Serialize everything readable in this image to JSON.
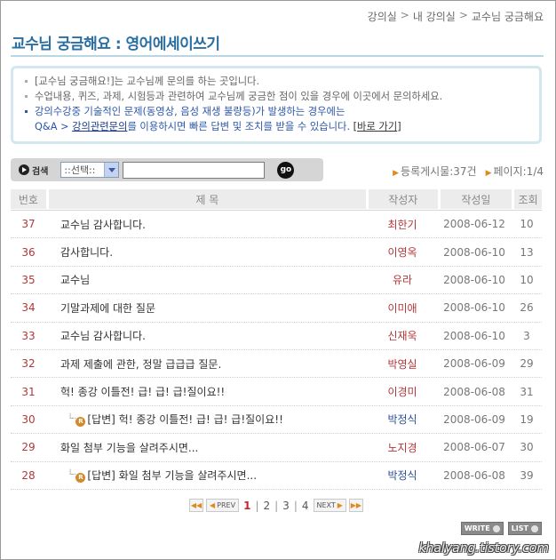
{
  "breadcrumb": [
    "강의실",
    "내 강의실",
    "교수님 궁금해요"
  ],
  "page_title": "교수님 궁금해요 : 영어에세이쓰기",
  "notice": {
    "line1": "[교수님 궁금해요!]는 교수님께 문의를 하는 곳입니다.",
    "line2": "수업내용, 퀴즈, 과제, 시험등과 관련하여 교수님께 궁금한 점이 있을 경우에 이곳에서 문의하세요.",
    "line3": "강의수강중 기술적인 문제(동영상, 음성 재생 불량등)가 발생하는 경우에는",
    "line4_prefix": "Q&A > ",
    "line4_link": "강의관련문의",
    "line4_suffix": "를 이용하시면 빠른 답변 및 조치를 받을 수 있습니다. ",
    "shortcut": "바로 가기"
  },
  "search": {
    "label": "검색",
    "select_value": "::선택::",
    "input_value": "",
    "go_label": "go"
  },
  "stats": {
    "count_label": "등록게시물:37건",
    "page_label": "페이지:1/4"
  },
  "columns": [
    "번호",
    "제 목",
    "작성자",
    "작성일",
    "조회"
  ],
  "rows": [
    {
      "num": "37",
      "title": "교수님 감사합니다.",
      "author": "최한기",
      "date": "2008-06-12",
      "views": "10",
      "reply": false,
      "author_color": "#b2373a"
    },
    {
      "num": "36",
      "title": "감사합니다.",
      "author": "이영옥",
      "date": "2008-06-10",
      "views": "13",
      "reply": false,
      "author_color": "#b2373a"
    },
    {
      "num": "35",
      "title": "교수님",
      "author": "유라",
      "date": "2008-06-10",
      "views": "10",
      "reply": false,
      "author_color": "#b2373a"
    },
    {
      "num": "34",
      "title": "기말과제에 대한 질문",
      "author": "이미애",
      "date": "2008-06-10",
      "views": "26",
      "reply": false,
      "author_color": "#b2373a"
    },
    {
      "num": "33",
      "title": "교수님 감사합니다.",
      "author": "신재욱",
      "date": "2008-06-10",
      "views": "3",
      "reply": false,
      "author_color": "#b2373a"
    },
    {
      "num": "32",
      "title": "과제 제출에 관한, 정말 급급급 질문.",
      "author": "박영실",
      "date": "2008-06-09",
      "views": "29",
      "reply": false,
      "author_color": "#b2373a"
    },
    {
      "num": "31",
      "title": "헉! 종강 이틀전! 급! 급! 급!질이요!!",
      "author": "이경미",
      "date": "2008-06-08",
      "views": "31",
      "reply": false,
      "author_color": "#b2373a"
    },
    {
      "num": "30",
      "title": "[답변] 헉! 종강 이틀전! 급! 급! 급!질이요!!",
      "author": "박정식",
      "date": "2008-06-09",
      "views": "19",
      "reply": true,
      "author_color": "#2d4f99"
    },
    {
      "num": "29",
      "title": "화일 첨부 기능을 살려주시면...",
      "author": "노지경",
      "date": "2008-06-07",
      "views": "30",
      "reply": false,
      "author_color": "#b2373a"
    },
    {
      "num": "28",
      "title": "[답변] 화일 첨부 기능을 살려주시면...",
      "author": "박정식",
      "date": "2008-06-08",
      "views": "39",
      "reply": true,
      "author_color": "#2d4f99"
    }
  ],
  "pager": {
    "prev_label": "PREV",
    "next_label": "NEXT",
    "pages": [
      "1",
      "2",
      "3",
      "4"
    ],
    "current": "1"
  },
  "actions": {
    "write_label": "WRITE",
    "list_label": "LIST"
  },
  "watermark": "khalyang.tistory.com"
}
